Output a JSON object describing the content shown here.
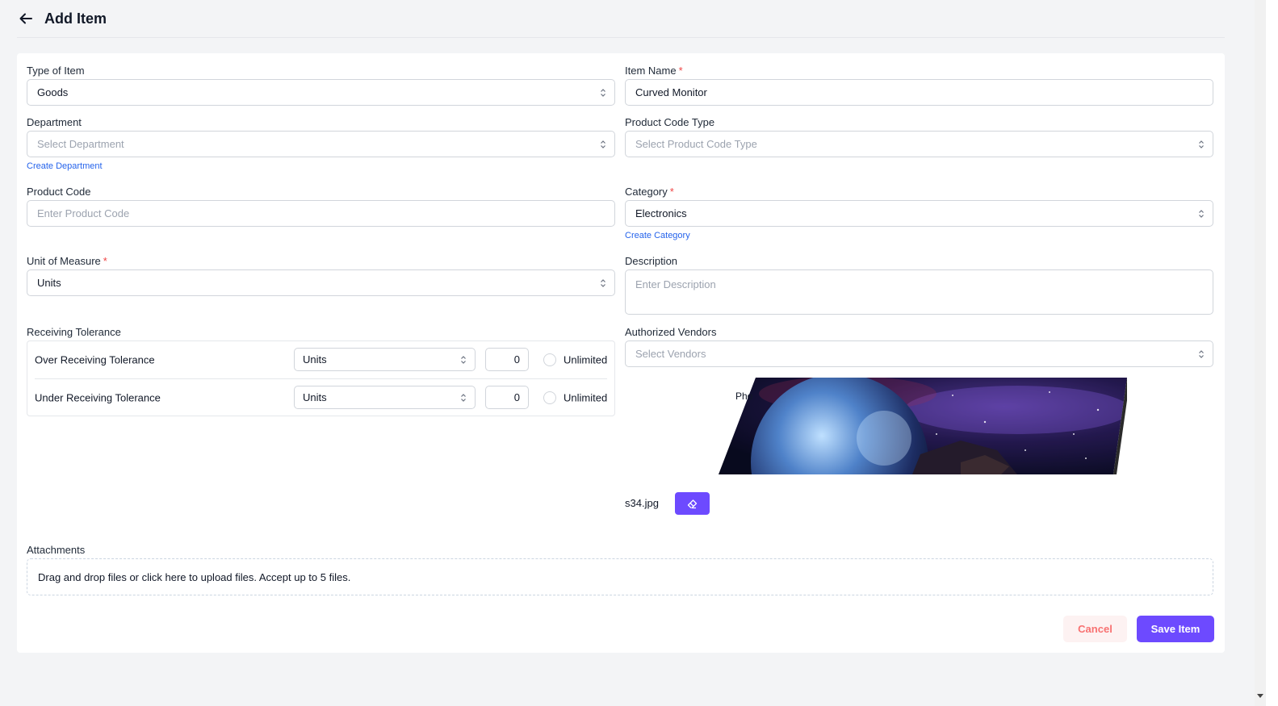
{
  "header": {
    "title": "Add Item",
    "back_icon": "arrow-left-icon"
  },
  "form": {
    "type_of_item": {
      "label": "Type of Item",
      "value": "Goods"
    },
    "item_name": {
      "label": "Item Name",
      "required_mark": "*",
      "value": "Curved Monitor"
    },
    "department": {
      "label": "Department",
      "placeholder": "Select Department",
      "create_link": "Create Department"
    },
    "product_code_type": {
      "label": "Product Code Type",
      "placeholder": "Select Product Code Type"
    },
    "product_code": {
      "label": "Product Code",
      "placeholder": "Enter Product Code"
    },
    "category": {
      "label": "Category",
      "required_mark": "*",
      "value": "Electronics",
      "create_link": "Create Category"
    },
    "unit_of_measure": {
      "label": "Unit of Measure",
      "required_mark": "*",
      "value": "Units"
    },
    "description": {
      "label": "Description",
      "placeholder": "Enter Description"
    },
    "receiving_tolerance": {
      "label": "Receiving Tolerance",
      "rows": [
        {
          "name": "Over Receiving Tolerance",
          "unit": "Units",
          "value": "0",
          "checkbox_label": "Unlimited"
        },
        {
          "name": "Under Receiving Tolerance",
          "unit": "Units",
          "value": "0",
          "checkbox_label": "Unlimited"
        }
      ]
    },
    "authorized_vendors": {
      "label": "Authorized Vendors",
      "placeholder": "Select Vendors"
    },
    "photo": {
      "overlay_text": "Pho",
      "file_name": "s34.jpg",
      "remove_icon": "eraser-icon"
    },
    "attachments": {
      "label": "Attachments",
      "dropzone_text": "Drag and drop files or click here to upload files. Accept up to 5 files."
    }
  },
  "actions": {
    "cancel_label": "Cancel",
    "save_label": "Save Item"
  },
  "colors": {
    "accent": "#6d4aff",
    "required": "#ef4444",
    "link": "#2563eb",
    "cancel_text": "#f87171"
  }
}
